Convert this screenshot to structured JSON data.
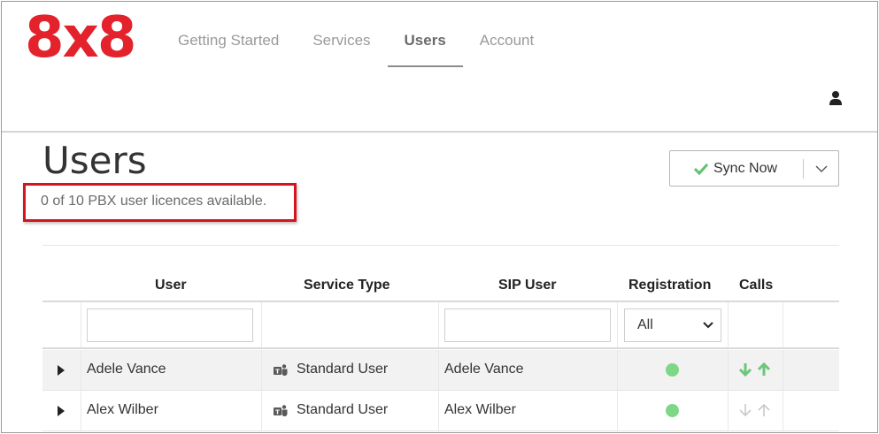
{
  "brand": {
    "logo_text": "8x8",
    "logo_color": "#e3222b"
  },
  "nav": {
    "items": [
      {
        "label": "Getting Started",
        "active": false
      },
      {
        "label": "Services",
        "active": false
      },
      {
        "label": "Users",
        "active": true
      },
      {
        "label": "Account",
        "active": false
      }
    ],
    "user_icon": "user-icon"
  },
  "page": {
    "title": "Users",
    "licence_notice": "0  of 10 PBX user licences available.",
    "highlight_color": "#d5141b"
  },
  "sync": {
    "label": "Sync Now",
    "check_icon": "check-icon",
    "check_color": "#5cc26b",
    "dropdown_icon": "chevron-down-icon"
  },
  "table": {
    "columns": [
      "User",
      "Service Type",
      "SIP User",
      "Registration",
      "Calls"
    ],
    "filters": {
      "user_value": "",
      "sip_user_value": "",
      "registration_selected": "All"
    },
    "rows": [
      {
        "user": "Adele Vance",
        "service_type": "Standard User",
        "service_icon": "teams-icon",
        "sip_user": "Adele Vance",
        "registration_status": "registered",
        "registration_color": "#7ed687",
        "calls_inbound": "enabled",
        "calls_outbound": "enabled"
      },
      {
        "user": "Alex Wilber",
        "service_type": "Standard User",
        "service_icon": "teams-icon",
        "sip_user": "Alex Wilber",
        "registration_status": "registered",
        "registration_color": "#7ed687",
        "calls_inbound": "disabled",
        "calls_outbound": "disabled"
      }
    ],
    "colors": {
      "arrow_enabled": "#6cc77a",
      "arrow_disabled": "#c9c9c9"
    }
  }
}
